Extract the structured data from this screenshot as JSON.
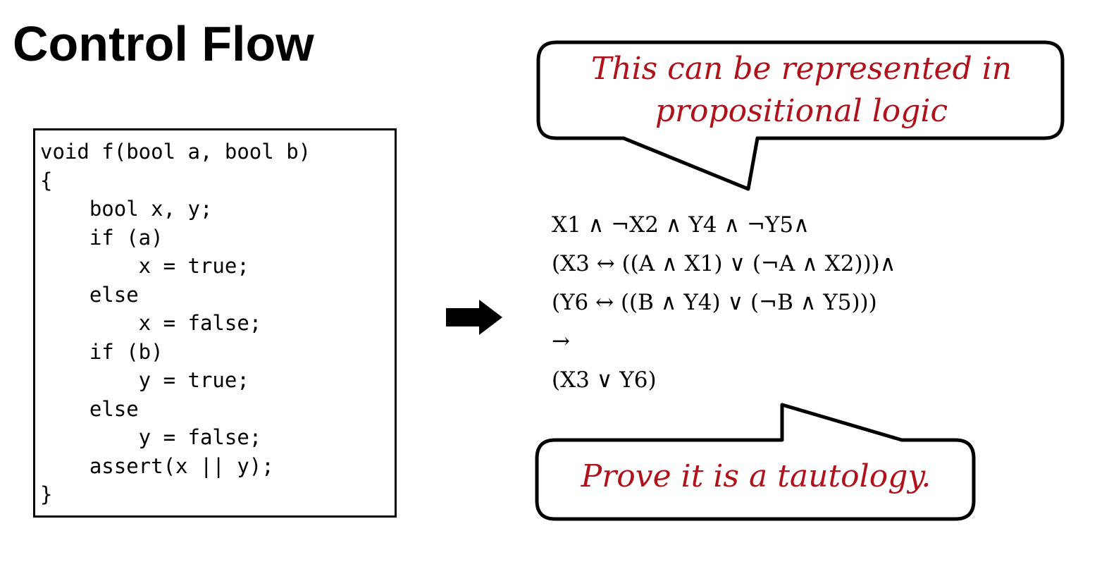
{
  "slide": {
    "title": "Control Flow"
  },
  "code": {
    "lines": [
      "void f(bool a, bool b)",
      "{",
      "    bool x, y;",
      "    if (a)",
      "        x = true;",
      "    else",
      "        x = false;",
      "    if (b)",
      "        y = true;",
      "    else",
      "        y = false;",
      "    assert(x || y);",
      "}"
    ]
  },
  "arrow": {
    "icon": "right-arrow-icon",
    "color": "#000000"
  },
  "callouts": {
    "top": {
      "line1": "This can be represented in",
      "line2": "propositional logic"
    },
    "bottom": {
      "text": "Prove it is a tautology."
    },
    "text_color": "#b0121b"
  },
  "formula": {
    "lines": [
      "X1 ∧ ¬X2 ∧ Y4 ∧ ¬Y5∧",
      "(X3 ↔ ((A ∧ X1) ∨ (¬A ∧ X2)))∧",
      "(Y6 ↔ ((B ∧ Y4) ∨ (¬B ∧ Y5)))",
      "→",
      "(X3 ∨ Y6)"
    ]
  }
}
